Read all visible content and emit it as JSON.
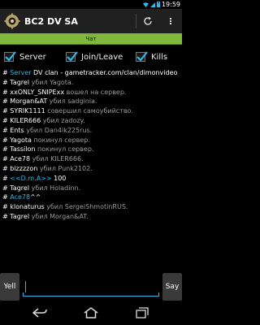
{
  "status_bar": {
    "time": "19:59"
  },
  "app": {
    "title": "BC2 DV SA"
  },
  "tab": {
    "label": "Чат"
  },
  "filters": [
    {
      "label": "Server",
      "checked": true
    },
    {
      "label": "Join/Leave",
      "checked": true
    },
    {
      "label": "Kills",
      "checked": true
    }
  ],
  "log": [
    {
      "prefix": "# ",
      "name": "Server",
      "text": " DV clan - gametracker.com/clan/dimonvideo",
      "style": "sys"
    },
    {
      "prefix": "# ",
      "name": "Tagrel",
      "text": " убил Yagota.",
      "style": "kill"
    },
    {
      "prefix": "# ",
      "name": "xxONLY_SNIPExx",
      "text": " вошел на сервер.",
      "style": "kill"
    },
    {
      "prefix": "# ",
      "name": "Morgan&AT",
      "text": " убил sadginia.",
      "style": "kill"
    },
    {
      "prefix": "# ",
      "name": "SYRIK1111",
      "text": " совершил самоубийство.",
      "style": "kill"
    },
    {
      "prefix": "# ",
      "name": "KILER666",
      "text": " убил zadozy.",
      "style": "kill"
    },
    {
      "prefix": "# ",
      "name": "Ents",
      "text": " убил Dan4ik225rus.",
      "style": "kill"
    },
    {
      "prefix": "# ",
      "name": "Yagota",
      "text": " покинул сервер.",
      "style": "kill"
    },
    {
      "prefix": "# ",
      "name": "Tassilon",
      "text": " покинул сервер.",
      "style": "kill"
    },
    {
      "prefix": "# ",
      "name": "Ace78",
      "text": " убил KILER666.",
      "style": "kill"
    },
    {
      "prefix": "# ",
      "name": "bizzzzon",
      "text": " убил Punk2102.",
      "style": "kill"
    },
    {
      "prefix": "# ",
      "name": "<<D.m.A>>",
      "text": " 100",
      "style": "chat"
    },
    {
      "prefix": "# ",
      "name": "Tagrel",
      "text": " убил Holadinn.",
      "style": "kill"
    },
    {
      "prefix": "# ",
      "name": "Ace78",
      "text": "^^",
      "style": "chat"
    },
    {
      "prefix": "# ",
      "name": "klonaturus",
      "text": " убил SergeiShmotinRUS.",
      "style": "kill"
    },
    {
      "prefix": "# ",
      "name": "Tagrel",
      "text": " убил Morgan&AT.",
      "style": "kill"
    }
  ],
  "input": {
    "yell_label": "Yell",
    "say_label": "Say",
    "value": ""
  },
  "colors": {
    "accent": "#33b5e5",
    "tab_bar": "#7fb83b",
    "action_bar": "#202020"
  },
  "icons": [
    "app-icon",
    "refresh-icon",
    "overflow-menu-icon",
    "back-icon",
    "home-icon",
    "recent-apps-icon",
    "wifi-icon",
    "signal-icon",
    "battery-icon"
  ]
}
